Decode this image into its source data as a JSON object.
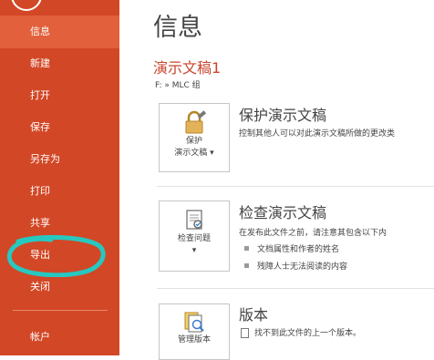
{
  "sidebar": {
    "items": [
      {
        "label": "信息"
      },
      {
        "label": "新建"
      },
      {
        "label": "打开"
      },
      {
        "label": "保存"
      },
      {
        "label": "另存为"
      },
      {
        "label": "打印"
      },
      {
        "label": "共享"
      },
      {
        "label": "导出"
      },
      {
        "label": "关闭"
      },
      {
        "label": "帐户"
      }
    ],
    "selected": "信息",
    "annotation_color": "#27c8c0",
    "background_color": "#d24726",
    "selected_color": "#e2603c"
  },
  "main": {
    "title": "信息",
    "document_title": "演示文稿1",
    "path": "F: » MLC 组",
    "protect": {
      "tile_line1": "保护",
      "tile_line2": "演示文稿",
      "heading": "保护演示文稿",
      "description": "控制其他人可以对此演示文稿所做的更改类"
    },
    "inspect": {
      "tile_label": "检查问题",
      "heading": "检查演示文稿",
      "description": "在发布此文件之前，请注意其包含以下内",
      "bullets": [
        "文档属性和作者的姓名",
        "残障人士无法阅读的内容"
      ]
    },
    "versions": {
      "tile_label": "管理版本",
      "heading": "版本",
      "description": "找不到此文件的上一个版本。"
    }
  }
}
